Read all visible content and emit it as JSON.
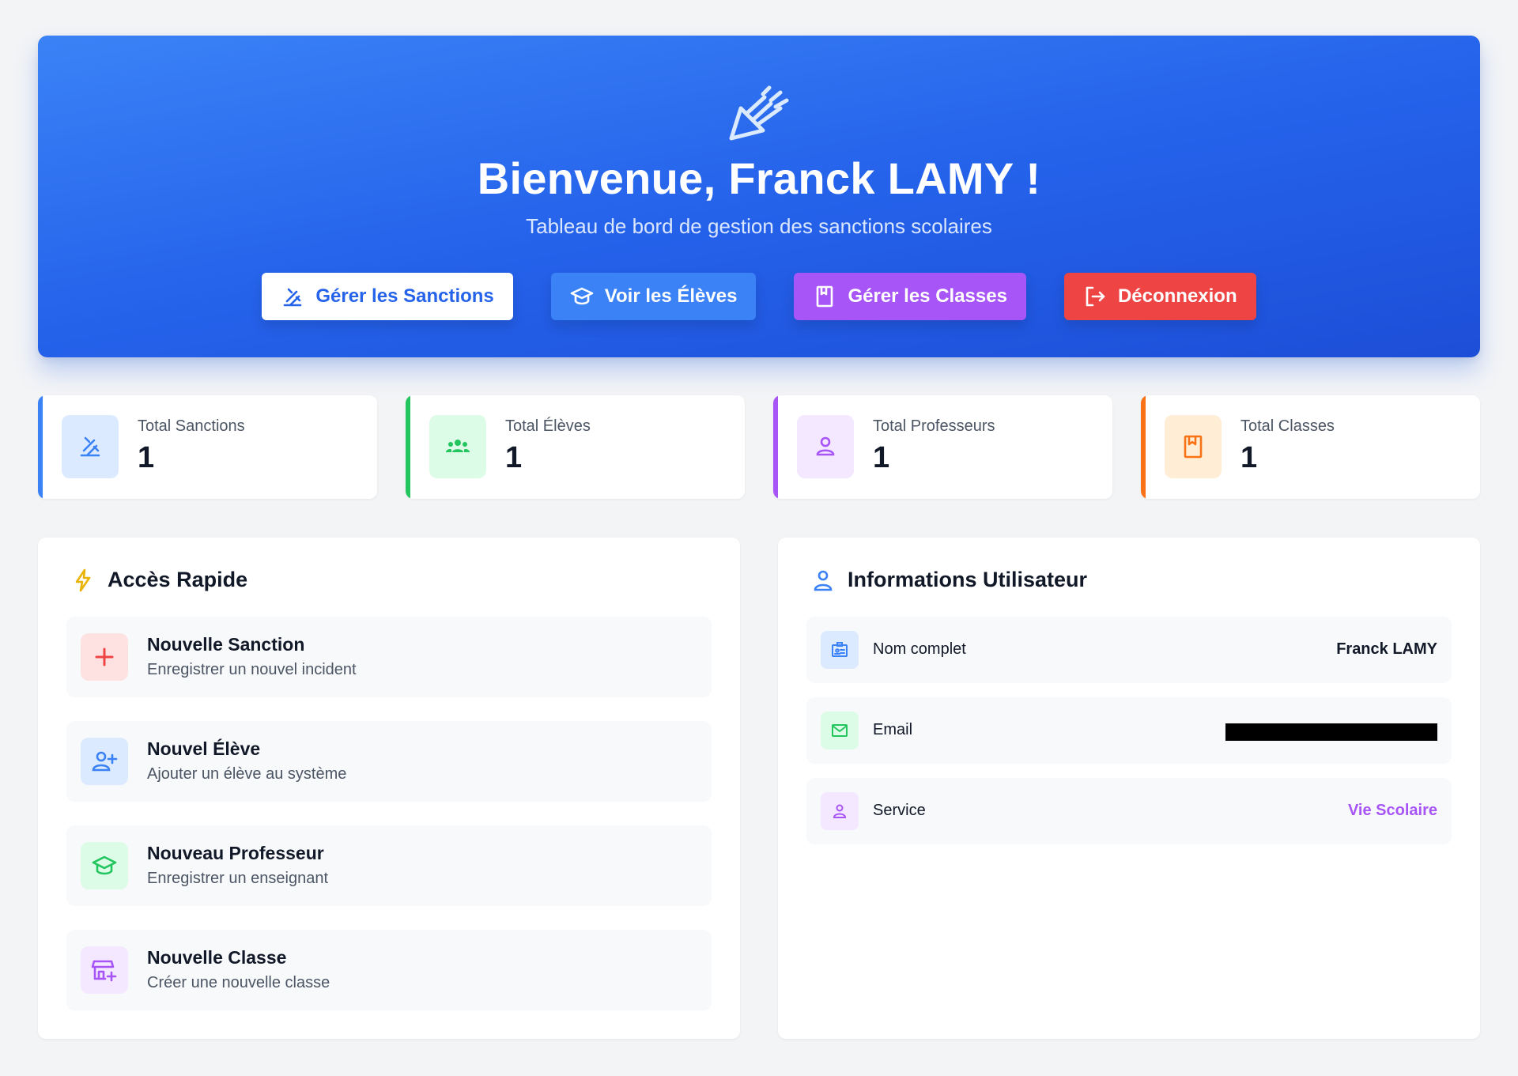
{
  "hero": {
    "title": "Bienvenue, Franck LAMY !",
    "subtitle": "Tableau de bord de gestion des sanctions scolaires",
    "icon": "gavel-icon",
    "actions": [
      {
        "label": "Gérer les Sanctions",
        "icon": "gavel-icon"
      },
      {
        "label": "Voir les Élèves",
        "icon": "graduation-cap-icon"
      },
      {
        "label": "Gérer les Classes",
        "icon": "book-icon"
      },
      {
        "label": "Déconnexion",
        "icon": "logout-icon"
      }
    ]
  },
  "stats": [
    {
      "label": "Total Sanctions",
      "value": "1",
      "icon": "gavel-icon",
      "accent": "#3b82f6",
      "soft": "#dbeafe"
    },
    {
      "label": "Total Élèves",
      "value": "1",
      "icon": "users-icon",
      "accent": "#22c55e",
      "soft": "#dcfce7"
    },
    {
      "label": "Total Professeurs",
      "value": "1",
      "icon": "user-icon",
      "accent": "#a855f7",
      "soft": "#f3e8ff"
    },
    {
      "label": "Total Classes",
      "value": "1",
      "icon": "book-icon",
      "accent": "#f97316",
      "soft": "#ffedd5"
    }
  ],
  "quick_access": {
    "title": "Accès Rapide",
    "icon": "bolt-icon",
    "items": [
      {
        "title": "Nouvelle Sanction",
        "desc": "Enregistrer un nouvel incident",
        "icon": "plus-icon",
        "color": "#ef4444",
        "soft": "#fee2e2"
      },
      {
        "title": "Nouvel Élève",
        "desc": "Ajouter un élève au système",
        "icon": "user-plus-icon",
        "color": "#3b82f6",
        "soft": "#dbeafe"
      },
      {
        "title": "Nouveau Professeur",
        "desc": "Enregistrer un enseignant",
        "icon": "graduation-cap-icon",
        "color": "#22c55e",
        "soft": "#dcfce7"
      },
      {
        "title": "Nouvelle Classe",
        "desc": "Créer une nouvelle classe",
        "icon": "store-plus-icon",
        "color": "#a855f7",
        "soft": "#f3e8ff"
      }
    ]
  },
  "user_info": {
    "title": "Informations Utilisateur",
    "icon": "user-icon",
    "rows": [
      {
        "label": "Nom complet",
        "value": "Franck LAMY",
        "icon": "id-card-icon",
        "color": "#3b82f6",
        "soft": "#dbeafe"
      },
      {
        "label": "Email",
        "value": "",
        "icon": "mail-icon",
        "color": "#22c55e",
        "soft": "#dcfce7"
      },
      {
        "label": "Service",
        "value": "Vie Scolaire",
        "icon": "user-icon",
        "color": "#a855f7",
        "soft": "#f3e8ff"
      }
    ]
  },
  "colors": {
    "hero_gradient_start": "#3b82f6",
    "hero_gradient_end": "#1d4ed8",
    "page_bg": "#f3f4f6"
  }
}
